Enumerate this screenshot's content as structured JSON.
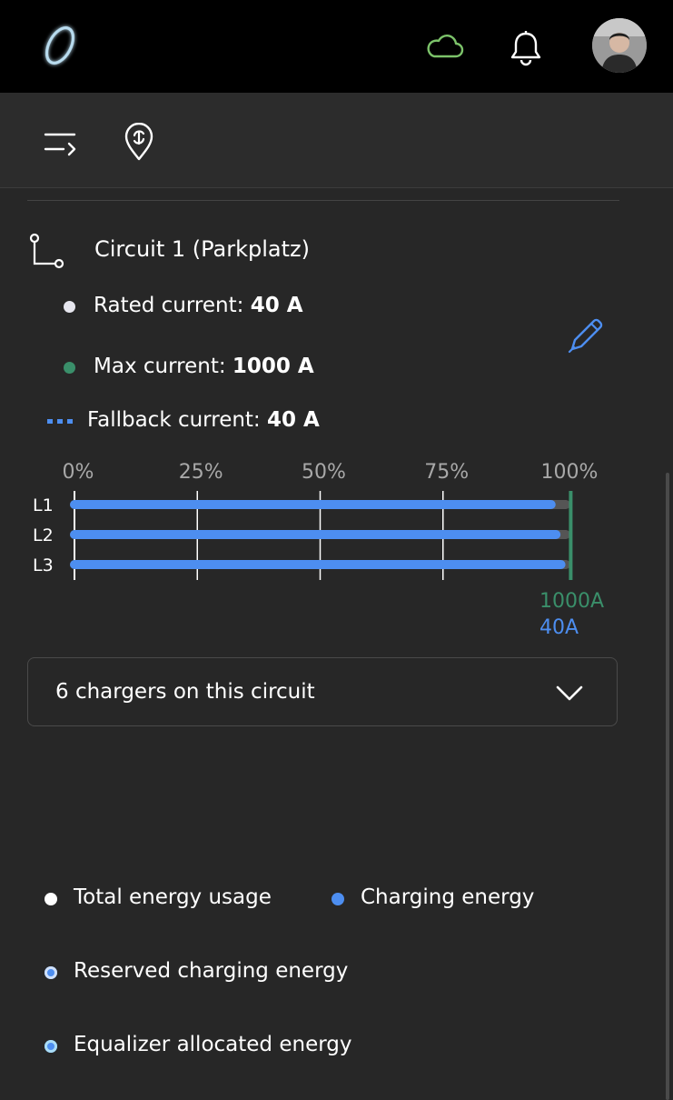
{
  "header": {
    "icons": [
      "logo",
      "cloud-icon",
      "bell-icon",
      "avatar"
    ],
    "cloud_color": "#7cc36a"
  },
  "toolbar": {
    "icons": [
      "menu-collapse-icon",
      "location-pin-icon"
    ]
  },
  "circuit": {
    "title": "Circuit 1 (Parkplatz)",
    "rated_label": "Rated current: ",
    "rated_value": "40 A",
    "max_label": "Max current: ",
    "max_value": "1000 A",
    "fallback_label": "Fallback current: ",
    "fallback_value": "40 A",
    "rated_color": "#e6e6ee",
    "max_color": "#3a8f6a",
    "fallback_color": "#4d8ef0"
  },
  "chart_data": {
    "type": "bar",
    "orientation": "horizontal",
    "categories": [
      "L1",
      "L2",
      "L3"
    ],
    "x_ticks": [
      "0%",
      "25%",
      "50%",
      "75%",
      "100%"
    ],
    "xlim": [
      0,
      100
    ],
    "series": [
      {
        "values": [
          97,
          98,
          99
        ],
        "color": "#4d8ef0"
      }
    ],
    "markers": [
      {
        "value": 101,
        "label": "1000A",
        "color": "#3a8f6a"
      },
      {
        "label": "40A",
        "color": "#4d8ef0"
      }
    ]
  },
  "chargers": {
    "label": "6 chargers on this circuit"
  },
  "energy_legend": [
    {
      "label": "Total energy usage",
      "color": "#ffffff"
    },
    {
      "label": "Charging energy",
      "color": "#4d8ef0"
    },
    {
      "label": "Reserved charging energy",
      "color": "#9ec3f7"
    },
    {
      "label": "Equalizer allocated energy",
      "color": "#7fc4f2"
    }
  ]
}
